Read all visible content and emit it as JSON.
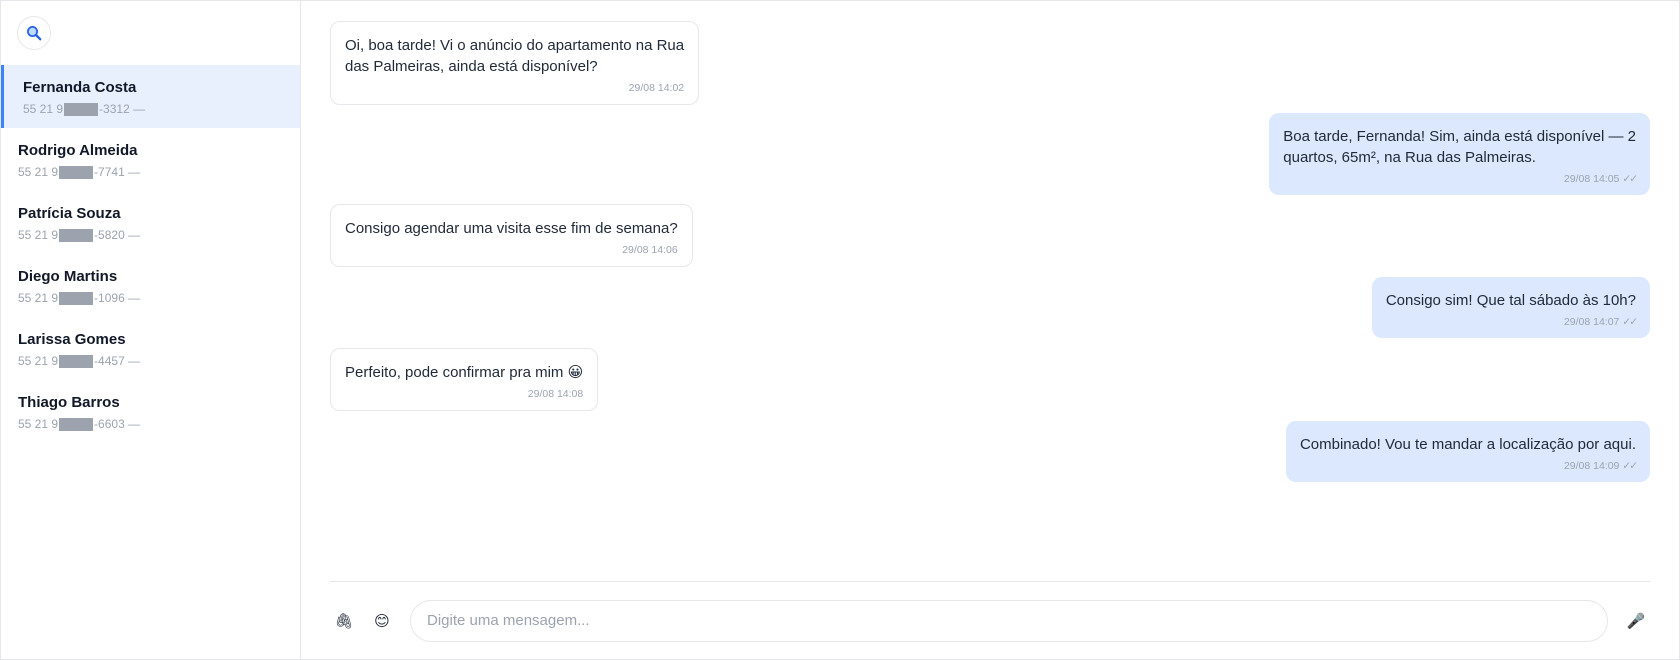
{
  "sidebar": {
    "search_icon": "magnifier-icon",
    "contacts": [
      {
        "name": "Fernanda Costa",
        "phone_prefix": "55 21 9",
        "phone_suffix": "-3312 —",
        "active": true
      },
      {
        "name": "Rodrigo Almeida",
        "phone_prefix": "55 21 9",
        "phone_suffix": "-7741 —",
        "active": false
      },
      {
        "name": "Patrícia Souza",
        "phone_prefix": "55 21 9",
        "phone_suffix": "-5820 —",
        "active": false
      },
      {
        "name": "Diego Martins",
        "phone_prefix": "55 21 9",
        "phone_suffix": "-1096 —",
        "active": false
      },
      {
        "name": "Larissa Gomes",
        "phone_prefix": "55 21 9",
        "phone_suffix": "-4457 —",
        "active": false
      },
      {
        "name": "Thiago Barros",
        "phone_prefix": "55 21 9",
        "phone_suffix": "-6603 —",
        "active": false
      }
    ]
  },
  "chat": {
    "messages": [
      {
        "direction": "in",
        "text_line1": "Oi, boa tarde! Vi o anúncio do apartamento na Rua",
        "text_line2": "das Palmeiras, ainda está disponível?",
        "time": "29/08 14:02"
      },
      {
        "direction": "out",
        "text_line1": "Boa tarde, Fernanda! Sim, ainda está disponível — 2",
        "text_line2": "quartos, 65m², na Rua das Palmeiras.",
        "time": "29/08 14:05",
        "status": "✓✓"
      },
      {
        "direction": "in",
        "text_line1": "Consigo agendar uma visita esse fim de semana?",
        "time": "29/08 14:06"
      },
      {
        "direction": "out",
        "text_line1": "Consigo sim! Que tal sábado às 10h?",
        "time": "29/08 14:07",
        "status": "✓✓"
      },
      {
        "direction": "in",
        "text_line1": "Perfeito, pode confirmar pra mim 😀",
        "time": "29/08 14:08"
      },
      {
        "direction": "out",
        "text_line1": "Combinado! Vou te mandar a localização por aqui.",
        "time": "29/08 14:09",
        "status": "✓✓"
      }
    ],
    "composer": {
      "attach_glyph": "🖇",
      "emoji_glyph": "😊",
      "mic_glyph": "🎤",
      "placeholder": "Digite uma mensagem..."
    }
  },
  "colors": {
    "accent": "#3b82f6",
    "active_contact_bg": "#e8f0fe",
    "outgoing_bubble": "#dbe8fd",
    "incoming_bubble": "#ffffff"
  }
}
